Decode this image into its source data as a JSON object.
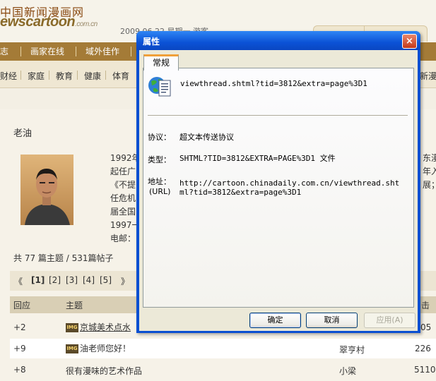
{
  "site": {
    "logo_cn": "中国新闻漫画网",
    "logo_en": "ewscartoon",
    "logo_domain": ".com.cn",
    "date_user": "2009.06.22 星期一  游客"
  },
  "nav": [
    "志",
    "画家在线",
    "域外佳作"
  ],
  "categories": [
    "财经",
    "家庭",
    "教育",
    "健康",
    "体育"
  ],
  "categories_right": "新漫",
  "author": {
    "name": "老油",
    "bio_lines": [
      "1992年",
      "起任广",
      "《不提",
      "任危机",
      "届全国",
      "1997一",
      "电邮："
    ],
    "bio_right": [
      "东漫",
      "",
      "年入",
      "展；",
      "",
      "",
      ""
    ]
  },
  "post_count": "共 77 篇主题 / 531篇帖子",
  "pager": {
    "first": "《",
    "pages": [
      "[1]",
      "[2]",
      "[3]",
      "[4]",
      "[5]"
    ],
    "next": "》"
  },
  "table": {
    "headers": {
      "replies": "回应",
      "topic": "主题",
      "right": "击"
    },
    "rows": [
      {
        "replies": "+2",
        "img_tag": "IMG",
        "topic": "京城美术点水",
        "author": "",
        "views": "05"
      },
      {
        "replies": "+9",
        "img_tag": "IMG",
        "topic": "油老师您好！",
        "author": "翠亨村",
        "views": "226"
      },
      {
        "replies": "+8",
        "img_tag": "",
        "topic": "很有漫味的艺术作品",
        "author": "小梁",
        "views": "5110"
      }
    ]
  },
  "dialog": {
    "title": "属性",
    "close_label": "×",
    "tab": "常规",
    "file_name": "viewthread.shtml?tid=3812&extra=page%3D1",
    "protocol_label": "协议：",
    "protocol_value": "超文本传送协议",
    "type_label": "类型：",
    "type_value": "SHTML?TID=3812&EXTRA=PAGE%3D1 文件",
    "address_label": "地址：",
    "address_label_sub": "(URL)",
    "address_line1": "http://cartoon.chinadaily.com.cn/viewthread.sht",
    "address_line2": "ml?tid=3812&extra=page%3D1",
    "ok": "确定",
    "cancel": "取消",
    "apply": "应用(A)"
  },
  "colors": {
    "nav_bar": "#a47b37",
    "titlebar": "#0b52d6",
    "close_button": "#c6391a",
    "tab_accent": "#f0a03a"
  },
  "icons": [
    "web-document-icon",
    "close-icon",
    "img-tag-icon"
  ]
}
